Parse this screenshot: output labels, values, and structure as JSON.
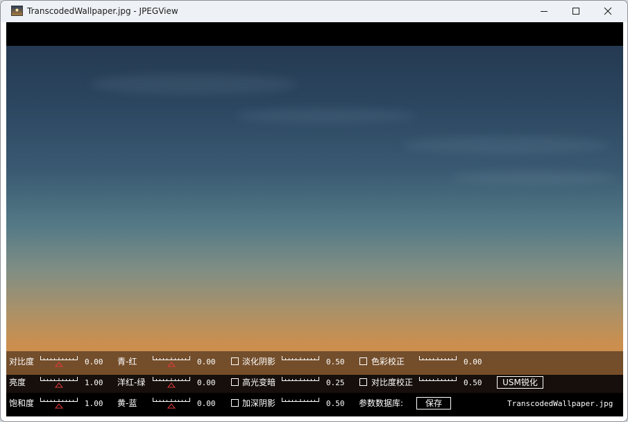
{
  "window": {
    "title": "TranscodedWallpaper.jpg - JPEGView",
    "controls": {
      "minimize": "minimize-icon",
      "maximize": "maximize-icon",
      "close": "close-icon"
    }
  },
  "image": {
    "file_name": "TranscodedWallpaper.jpg"
  },
  "adjust_panel": {
    "sliders": [
      {
        "label": "对比度",
        "value": "0.00",
        "pointer": 0.5
      },
      {
        "label": "亮度",
        "value": "1.00",
        "pointer": 0.5
      },
      {
        "label": "饱和度",
        "value": "1.00",
        "pointer": 0.5
      },
      {
        "label": "青-红",
        "value": "0.00",
        "pointer": 0.5
      },
      {
        "label": "洋红-绿",
        "value": "0.00",
        "pointer": 0.5
      },
      {
        "label": "黄-蓝",
        "value": "0.00",
        "pointer": 0.5
      }
    ],
    "checks": [
      {
        "label": "淡化阴影",
        "value": "0.50",
        "checked": false
      },
      {
        "label": "高光变暗",
        "value": "0.25",
        "checked": false
      },
      {
        "label": "加深阴影",
        "value": "0.50",
        "checked": false
      },
      {
        "label": "色彩校正",
        "value": "0.00",
        "checked": false
      },
      {
        "label": "对比度校正",
        "value": "0.50",
        "checked": false
      }
    ],
    "usm_button": "USM锐化",
    "param_db_label": "参数数据库:",
    "save_button": "保存"
  }
}
